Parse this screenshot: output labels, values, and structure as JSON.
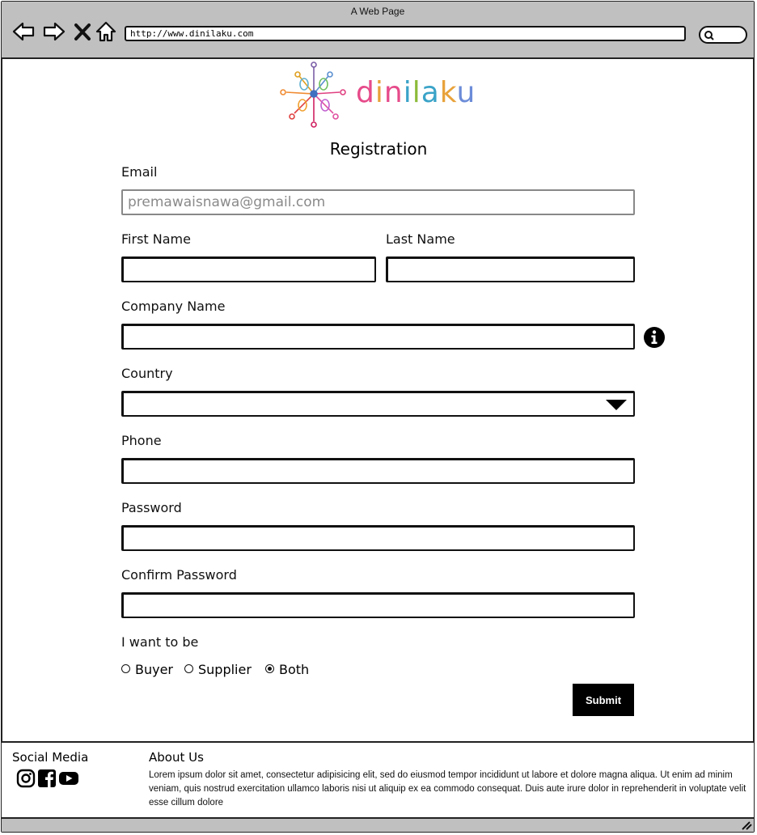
{
  "window": {
    "title": "A Web Page",
    "url": "http://www.dinilaku.com"
  },
  "brand": {
    "name": "dinilaku"
  },
  "form": {
    "title": "Registration",
    "email": {
      "label": "Email",
      "value": "premawaisnawa@gmail.com"
    },
    "first_name": {
      "label": "First Name",
      "value": ""
    },
    "last_name": {
      "label": "Last Name",
      "value": ""
    },
    "company_name": {
      "label": "Company Name",
      "value": ""
    },
    "country": {
      "label": "Country",
      "value": ""
    },
    "phone": {
      "label": "Phone",
      "value": ""
    },
    "password": {
      "label": "Password",
      "value": ""
    },
    "confirm_password": {
      "label": "Confirm Password",
      "value": ""
    },
    "role": {
      "label": "I want to be",
      "options": [
        "Buyer",
        "Supplier",
        "Both"
      ],
      "selected": "Both"
    },
    "submit_label": "Submit"
  },
  "footer": {
    "social_heading": "Social Media",
    "social_icons": [
      "instagram-icon",
      "facebook-icon",
      "youtube-icon"
    ],
    "about_heading": "About Us",
    "about_text": "Lorem ipsum dolor sit amet, consectetur adipisicing elit, sed do eiusmod tempor incididunt ut labore et dolore magna aliqua. Ut enim ad minim veniam, quis nostrud exercitation ullamco laboris nisi ut aliquip ex ea commodo consequat. Duis aute irure dolor in reprehenderit in voluptate velit esse cillum dolore"
  },
  "colors": {
    "chrome": "#c0c0c0",
    "button": "#000000",
    "placeholder_text": "#8a8a8a"
  }
}
